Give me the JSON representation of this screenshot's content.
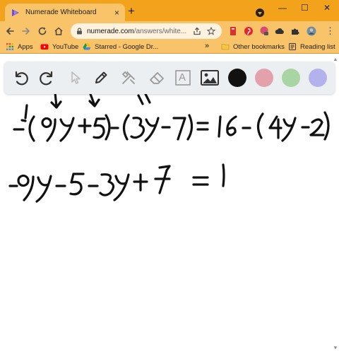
{
  "tab": {
    "title": "Numerade Whiteboard",
    "close": "×"
  },
  "new_tab": "+",
  "window_controls": {
    "minimize": "—",
    "maximize": "☐",
    "close": "✕"
  },
  "omnibox": {
    "domain": "numerade.com",
    "path": "/answers/white..."
  },
  "menu": "⋮",
  "bookmarks": {
    "apps": "Apps",
    "youtube": "YouTube",
    "starred": "Starred - Google Dr...",
    "overflow": "»",
    "other": "Other bookmarks",
    "reading": "Reading list"
  },
  "colors": {
    "chrome_orange": "#f3a21b",
    "toolbar_orange": "#f9c36a",
    "swatch_black": "#111111",
    "swatch_pink": "#e3a2ab",
    "swatch_green": "#a8d5a3",
    "swatch_purple": "#b4b2ec"
  },
  "whiteboard": {
    "tools": [
      "undo-icon",
      "redo-icon",
      "pointer-icon",
      "pen-icon",
      "tools-icon",
      "eraser-icon",
      "text-icon",
      "image-icon"
    ],
    "text_tool_label": "A"
  },
  "icons": [
    "reload-icon",
    "home-icon",
    "share-icon",
    "star-icon",
    "lock-icon",
    "puzzle-icon",
    "avatar-icon"
  ]
}
